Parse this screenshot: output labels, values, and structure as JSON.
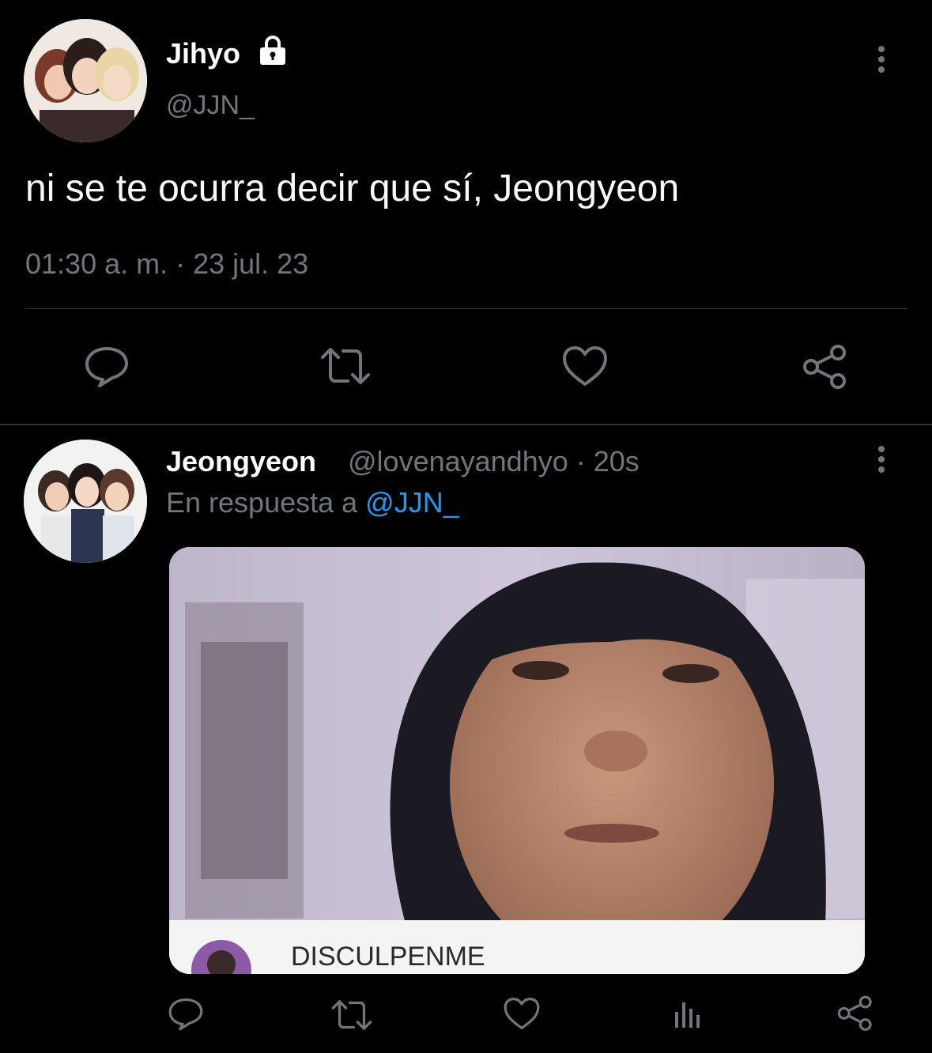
{
  "main_tweet": {
    "author_name": "Jihyo",
    "handle": "@JJN_",
    "text": "ni se te ocurra decir que sí, Jeongyeon",
    "timestamp": "01:30 a. m. · 23 jul. 23",
    "icons": [
      "lock-icon",
      "more-vertical-icon",
      "reply-icon",
      "retweet-icon",
      "like-icon",
      "share-icon"
    ]
  },
  "reply_tweet": {
    "author_name": "Jeongyeon",
    "handle_time": "@lovenayandhyo · 20s",
    "reply_prefix": "En respuesta a",
    "reply_to": "@JJN_",
    "media_caption": "DISCULPENME",
    "icons": [
      "more-vertical-icon",
      "reply-icon",
      "retweet-icon",
      "like-icon",
      "analytics-icon",
      "share-icon"
    ]
  },
  "colors": {
    "background": "#000000",
    "text": "#e7e9ea",
    "muted": "#71767b",
    "accent": "#1d9bf0",
    "divider": "#2f3336"
  }
}
